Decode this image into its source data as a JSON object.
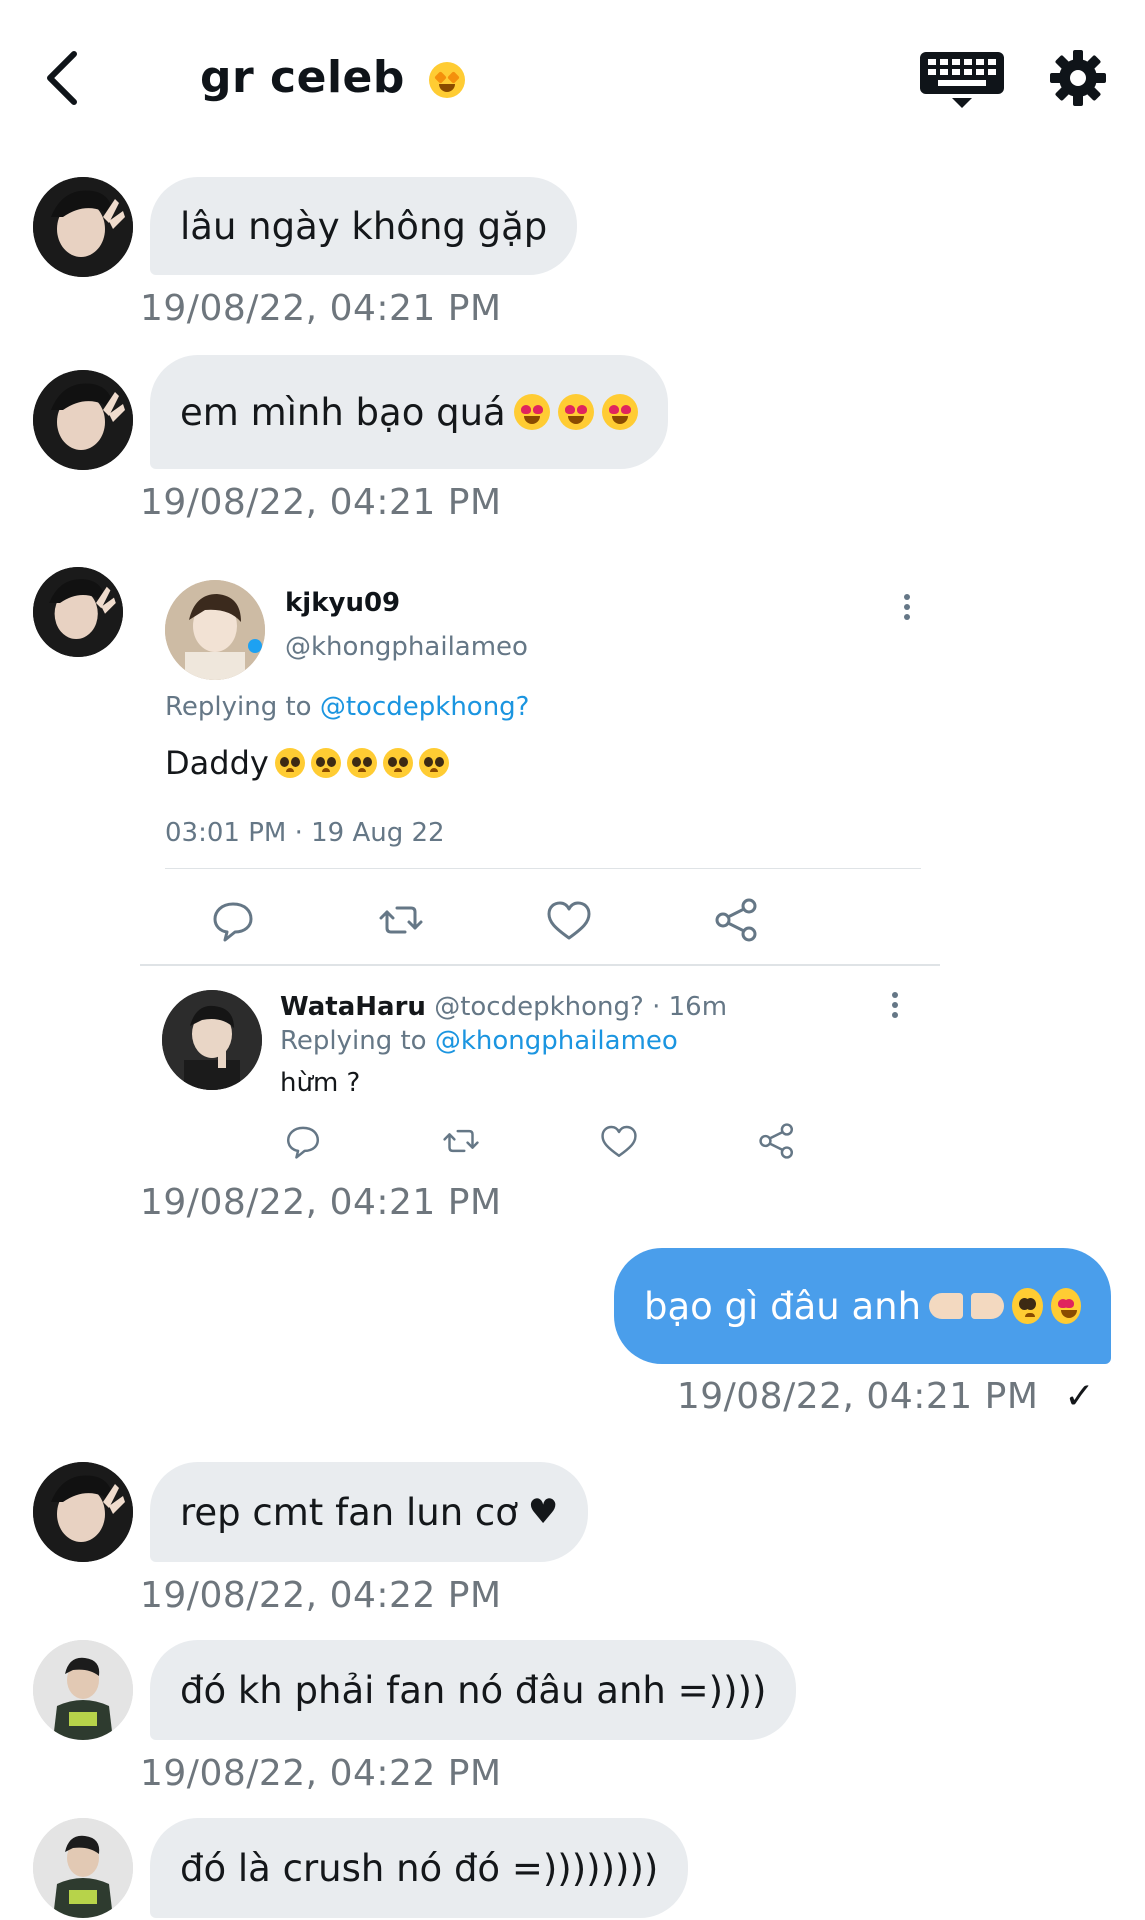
{
  "header": {
    "title": "gr celeb",
    "title_emoji": "star-struck-emoji",
    "back_icon": "chevron-left-icon",
    "keyboard_icon": "keyboard-icon",
    "settings_icon": "gear-icon"
  },
  "messages": [
    {
      "text": "lâu ngày không gặp",
      "time": "19/08/22, 04:21 PM"
    },
    {
      "text": "em mình bạo quá",
      "time": "19/08/22, 04:21 PM"
    },
    {
      "time": "19/08/22, 04:21 PM"
    },
    {
      "text": "bạo gì đâu anh",
      "time": "19/08/22, 04:21 PM",
      "check": "✓"
    },
    {
      "text": "rep cmt fan lun cơ",
      "heart": "♥",
      "time": "19/08/22, 04:22 PM"
    },
    {
      "text": "đó kh phải fan nó đâu anh =))))",
      "time": "19/08/22, 04:22 PM"
    },
    {
      "text": "đó là crush nó đó =))))))))"
    }
  ],
  "tweet": {
    "name": "kjkyu09",
    "handle": "@khongphailameo",
    "replying_to_label": "Replying to",
    "replying_to": "@tocdepkhong?",
    "text": "Daddy",
    "time": "03:01 PM · 19 Aug 22",
    "reply": {
      "name": "WataHaru",
      "meta": "@tocdepkhong? · 16m",
      "replying_to_label": "Replying to",
      "replying_to": "@khongphailameo",
      "text": "hừm ?"
    }
  },
  "colors": {
    "outgoing_bubble": "#4a9eeb",
    "incoming_bubble": "#e9ecef",
    "timestamp": "#6e767d",
    "mention": "#1b95e0"
  }
}
